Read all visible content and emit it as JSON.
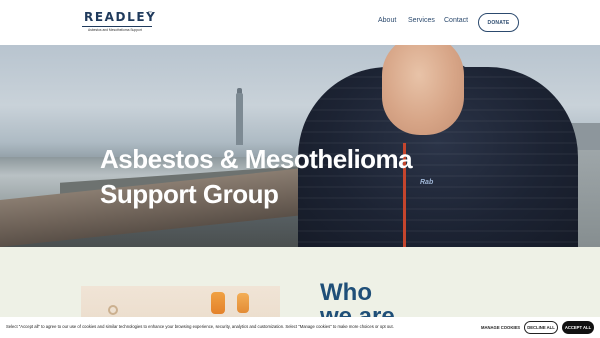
{
  "header": {
    "logo": {
      "word": "READLEY",
      "tm": "™",
      "tagline": "Asbestos and Mesothelioma Support"
    },
    "nav": [
      {
        "label": "About"
      },
      {
        "label": "Services"
      },
      {
        "label": "Contact"
      }
    ],
    "donate_label": "DONATE",
    "colors": {
      "brand": "#1f3a5c",
      "nav": "#2c4a6e"
    }
  },
  "hero": {
    "title_line1": "Asbestos & Mesothelioma",
    "title_line2": "Support Group",
    "jacket_brand": "Rab"
  },
  "about": {
    "heading_line1": "Who",
    "heading_line2": "we are",
    "heading_color": "#1f4f78"
  },
  "cookie_banner": {
    "text": "Select \"Accept all\" to agree to our use of cookies and similar technologies to enhance your browsing experience, security, analytics and customization. Select \"Manage cookies\" to make more choices or opt out.",
    "manage_label": "MANAGE COOKIES",
    "decline_label": "DECLINE ALL",
    "accept_label": "ACCEPT ALL"
  }
}
